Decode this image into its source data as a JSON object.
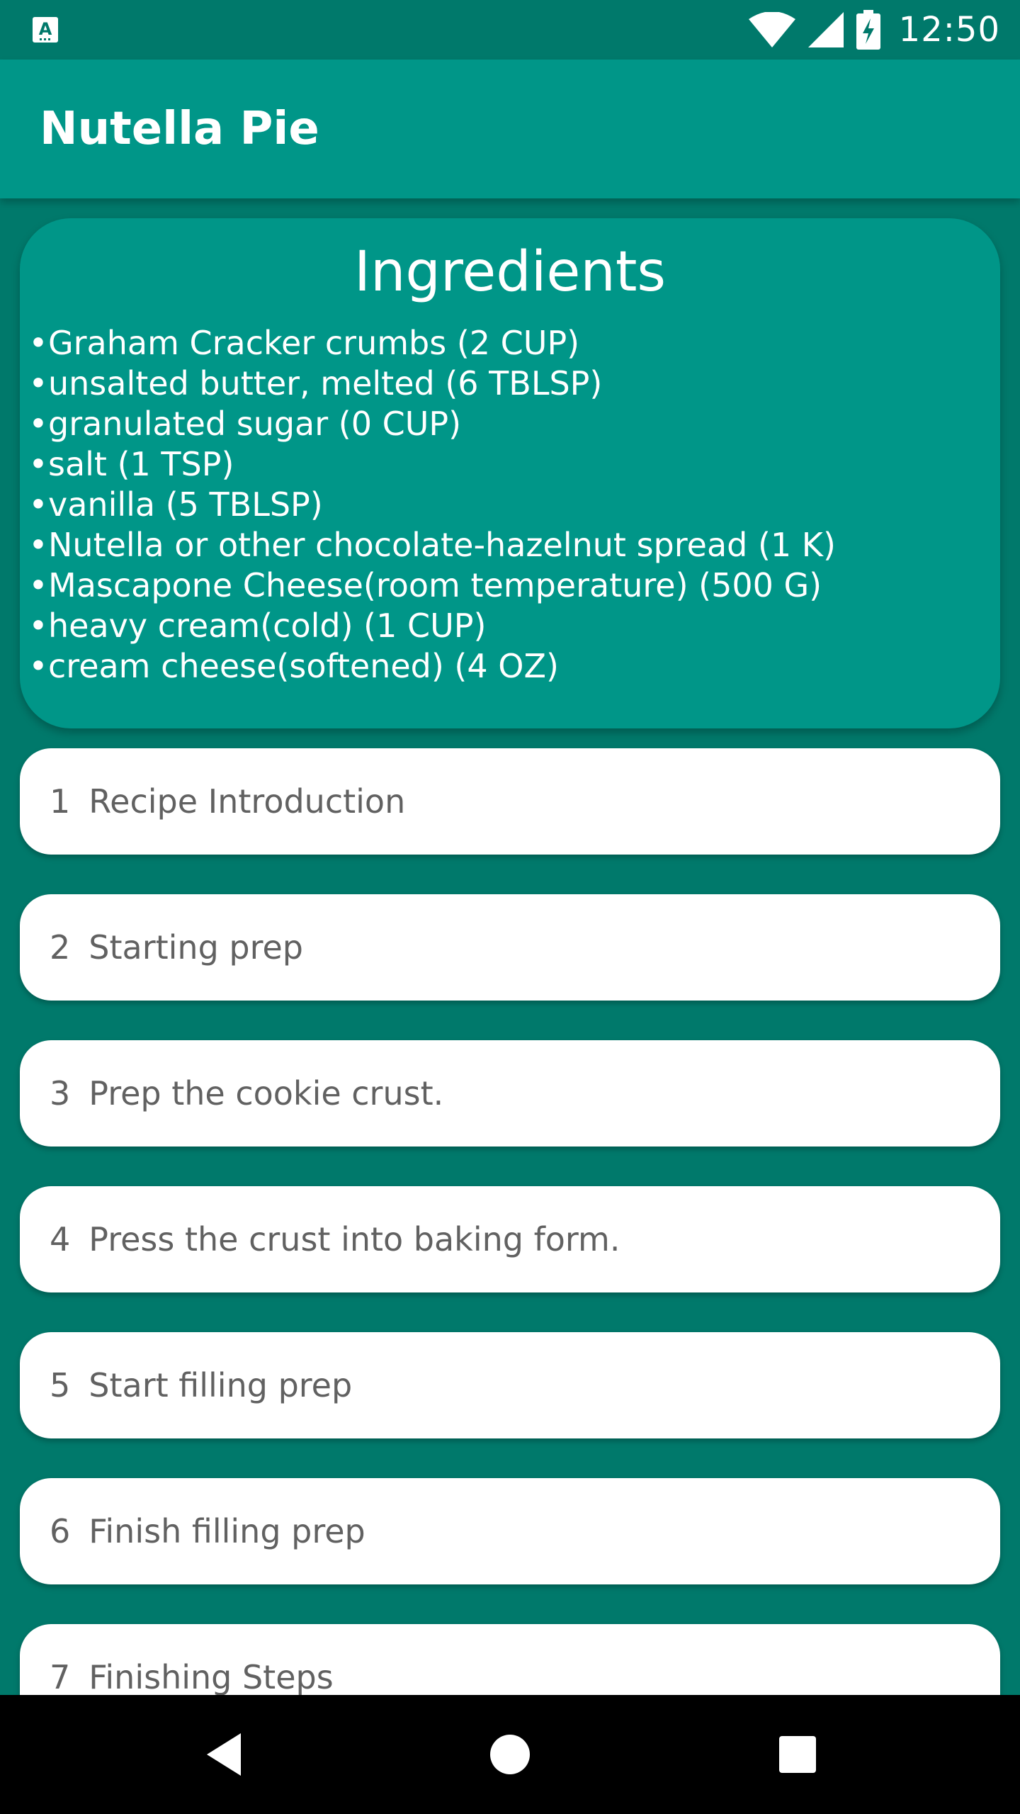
{
  "status_bar": {
    "time": "12:50",
    "left_icon": "keyboard-a-icon",
    "icons": [
      "wifi-icon",
      "signal-icon",
      "battery-charging-icon"
    ]
  },
  "app_bar": {
    "title": "Nutella Pie"
  },
  "ingredients": {
    "title": "Ingredients",
    "bullet": "•",
    "items": [
      "Graham Cracker crumbs (2 CUP)",
      "unsalted butter, melted (6 TBLSP)",
      "granulated sugar (0 CUP)",
      "salt (1 TSP)",
      "vanilla (5 TBLSP)",
      "Nutella or other chocolate-hazelnut spread (1 K)",
      "Mascapone Cheese(room temperature) (500 G)",
      "heavy cream(cold) (1 CUP)",
      "cream cheese(softened) (4 OZ)"
    ]
  },
  "steps": [
    {
      "number": "1",
      "label": "Recipe Introduction"
    },
    {
      "number": "2",
      "label": "Starting prep"
    },
    {
      "number": "3",
      "label": "Prep the cookie crust."
    },
    {
      "number": "4",
      "label": "Press the crust into baking form."
    },
    {
      "number": "5",
      "label": "Start filling prep"
    },
    {
      "number": "6",
      "label": "Finish filling prep"
    },
    {
      "number": "7",
      "label": "Finishing Steps"
    }
  ],
  "nav_bar": {
    "buttons": [
      "back-icon",
      "home-icon",
      "recents-icon"
    ]
  },
  "colors": {
    "primary_dark": "#00796B",
    "primary": "#009688",
    "card": "#FFFFFF",
    "step_text": "#616161"
  }
}
